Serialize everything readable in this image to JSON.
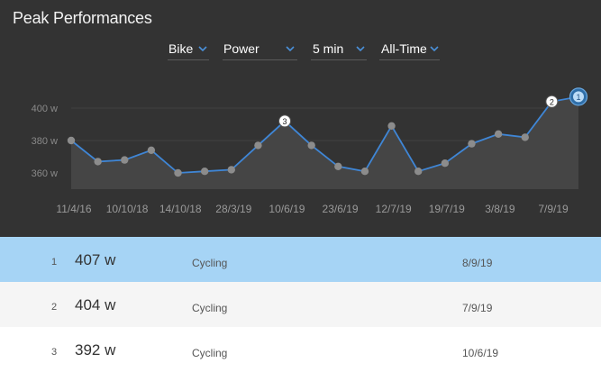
{
  "title": "Peak Performances",
  "filters": [
    {
      "label": "Bike"
    },
    {
      "label": "Power"
    },
    {
      "label": "5 min"
    },
    {
      "label": "All-Time"
    }
  ],
  "colors": {
    "panel_bg": "#333333",
    "line": "#3f86d6",
    "point": "#8c8c8c",
    "area": "#454545",
    "grid": "#404040",
    "highlight_row": "#a6d4f5",
    "accent": "#4a90d9"
  },
  "chart_data": {
    "type": "line",
    "ylabel": "",
    "xlabel": "",
    "ylim": [
      350,
      410
    ],
    "yticks": [
      360,
      380,
      400
    ],
    "ytick_labels": [
      "360 w",
      "380 w",
      "400 w"
    ],
    "x_tick_labels": [
      "11/4/16",
      "10/10/18",
      "14/10/18",
      "28/3/19",
      "10/6/19",
      "23/6/19",
      "12/7/19",
      "19/7/19",
      "3/8/19",
      "7/9/19"
    ],
    "values": [
      380,
      367,
      368,
      374,
      360,
      361,
      362,
      377,
      392,
      377,
      364,
      361,
      389,
      361,
      366,
      378,
      384,
      382,
      404,
      407
    ],
    "markers": [
      {
        "index": 19,
        "label": "1"
      },
      {
        "index": 18,
        "label": "2"
      },
      {
        "index": 8,
        "label": "3"
      }
    ],
    "grid": true
  },
  "table": {
    "rows": [
      {
        "rank": "1",
        "value": "407",
        "unit": "w",
        "activity": "Cycling",
        "date": "8/9/19"
      },
      {
        "rank": "2",
        "value": "404",
        "unit": "w",
        "activity": "Cycling",
        "date": "7/9/19"
      },
      {
        "rank": "3",
        "value": "392",
        "unit": "w",
        "activity": "Cycling",
        "date": "10/6/19"
      }
    ]
  }
}
